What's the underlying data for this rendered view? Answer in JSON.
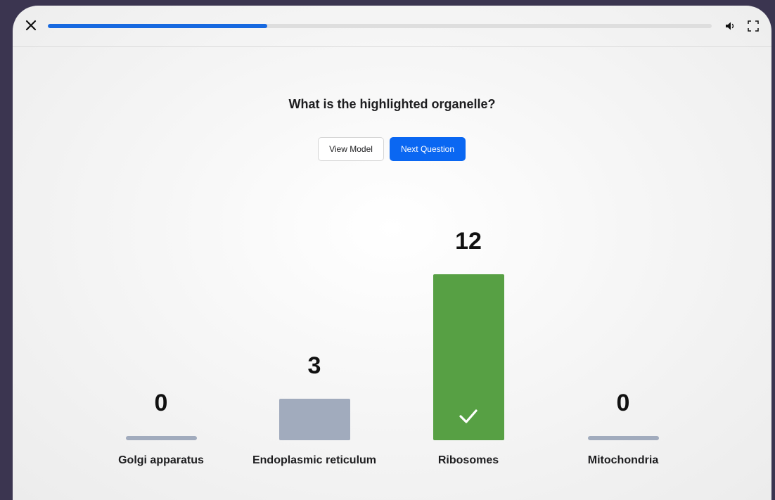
{
  "progress": {
    "fraction": 0.33
  },
  "question": {
    "text": "What is the highlighted organelle?"
  },
  "buttons": {
    "view_model": "View Model",
    "next_question": "Next Question"
  },
  "icons": {
    "close": "close-icon",
    "speaker": "speaker-icon",
    "fullscreen": "fullscreen-icon",
    "check": "check-icon"
  },
  "colors": {
    "correct": "#57a044",
    "neutral": "#a1abbd",
    "accent": "#0a67f2"
  },
  "chart_data": {
    "type": "bar",
    "categories": [
      "Golgi apparatus",
      "Endoplasmic reticulum",
      "Ribosomes",
      "Mitochondria"
    ],
    "values": [
      0,
      3,
      12,
      0
    ],
    "correct_index": 2,
    "title": "",
    "xlabel": "",
    "ylabel": ""
  }
}
